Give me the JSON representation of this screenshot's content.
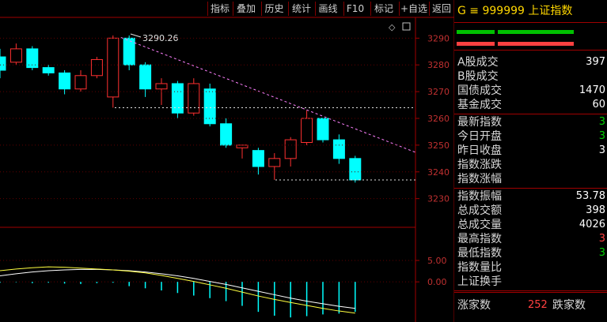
{
  "toolbar": {
    "buttons": [
      "指标",
      "叠加",
      "历史",
      "统计",
      "画线",
      "F10",
      "标记",
      "+自选",
      "返回"
    ]
  },
  "chart_data": {
    "type": "candlestick",
    "y_axis_ticks": [
      3290,
      3280,
      3270,
      3260,
      3250,
      3240,
      3230
    ],
    "ylim": [
      3224,
      3296
    ],
    "high_annotation": "3290.26",
    "candles": [
      {
        "o": 3283,
        "c": 3278,
        "h": 3286,
        "l": 3275,
        "dir": "down"
      },
      {
        "o": 3281,
        "c": 3286,
        "h": 3288,
        "l": 3280,
        "dir": "up"
      },
      {
        "o": 3286,
        "c": 3279,
        "h": 3287,
        "l": 3278,
        "dir": "down"
      },
      {
        "o": 3279,
        "c": 3277,
        "h": 3280,
        "l": 3276,
        "dir": "down"
      },
      {
        "o": 3277,
        "c": 3271,
        "h": 3278,
        "l": 3269,
        "dir": "down"
      },
      {
        "o": 3271,
        "c": 3276,
        "h": 3278,
        "l": 3270,
        "dir": "up"
      },
      {
        "o": 3276,
        "c": 3282,
        "h": 3283,
        "l": 3275,
        "dir": "up"
      },
      {
        "o": 3268,
        "c": 3290,
        "h": 3291,
        "l": 3264,
        "dir": "up"
      },
      {
        "o": 3290,
        "c": 3280,
        "h": 3291,
        "l": 3278,
        "dir": "down"
      },
      {
        "o": 3280,
        "c": 3271,
        "h": 3281,
        "l": 3268,
        "dir": "down"
      },
      {
        "o": 3271,
        "c": 3273,
        "h": 3275,
        "l": 3265,
        "dir": "up"
      },
      {
        "o": 3273,
        "c": 3262,
        "h": 3274,
        "l": 3260,
        "dir": "down"
      },
      {
        "o": 3262,
        "c": 3273,
        "h": 3275,
        "l": 3261,
        "dir": "up"
      },
      {
        "o": 3271,
        "c": 3258,
        "h": 3273,
        "l": 3257,
        "dir": "down"
      },
      {
        "o": 3258,
        "c": 3250,
        "h": 3260,
        "l": 3249,
        "dir": "down"
      },
      {
        "o": 3249,
        "c": 3250,
        "h": 3250,
        "l": 3245,
        "dir": "up"
      },
      {
        "o": 3248,
        "c": 3242,
        "h": 3249,
        "l": 3239,
        "dir": "down"
      },
      {
        "o": 3242,
        "c": 3245,
        "h": 3247,
        "l": 3237,
        "dir": "up"
      },
      {
        "o": 3245,
        "c": 3252,
        "h": 3253,
        "l": 3242,
        "dir": "up"
      },
      {
        "o": 3251,
        "c": 3260,
        "h": 3263,
        "l": 3250,
        "dir": "up"
      },
      {
        "o": 3260,
        "c": 3252,
        "h": 3260,
        "l": 3251,
        "dir": "down"
      },
      {
        "o": 3252,
        "c": 3245,
        "h": 3254,
        "l": 3243,
        "dir": "down"
      },
      {
        "o": 3245,
        "c": 3237,
        "h": 3246,
        "l": 3236,
        "dir": "down"
      }
    ],
    "sub_axis_ticks": [
      "5.00",
      "0.00"
    ],
    "sub_ylim": [
      -9,
      12
    ],
    "sub_bars": [
      -0.2,
      -0.1,
      -0.3,
      -0.2,
      -0.4,
      -0.5,
      -0.3,
      -0.2,
      -1.0,
      -1.5,
      -2.0,
      -2.6,
      -3.2,
      -3.8,
      -4.5,
      -5.6,
      -7.0,
      -7.9,
      -8.3,
      -8.0,
      -7.6,
      -7.4,
      -7.0
    ],
    "sub_line_yellow": [
      2.6,
      3.0,
      3.3,
      3.5,
      3.4,
      3.2,
      3.0,
      2.8,
      2.5,
      2.1,
      1.5,
      0.8,
      0.1,
      -0.7,
      -1.5,
      -2.4,
      -3.3,
      -4.1,
      -4.8,
      -5.5,
      -6.2,
      -6.8,
      -7.3
    ],
    "sub_line_white": [
      1.4,
      1.9,
      2.3,
      2.6,
      2.8,
      2.9,
      2.9,
      2.8,
      2.6,
      2.3,
      1.9,
      1.4,
      0.8,
      0.1,
      -0.6,
      -1.4,
      -2.2,
      -3.0,
      -3.8,
      -4.5,
      -5.1,
      -5.7,
      -6.2
    ]
  },
  "side": {
    "title": "G ≡ 999999 上证指数",
    "rows": [
      {
        "label": "A股成交",
        "value": "397",
        "cls": "val-white"
      },
      {
        "label": "B股成交",
        "value": "",
        "cls": "val-white"
      },
      {
        "label": "国债成交",
        "value": "1470",
        "cls": "val-white"
      },
      {
        "label": "基金成交",
        "value": "60",
        "cls": "val-white"
      },
      {
        "label": "最新指数",
        "value": "3",
        "cls": "val-green"
      },
      {
        "label": "今日开盘",
        "value": "3",
        "cls": "val-green"
      },
      {
        "label": "昨日收盘",
        "value": "3",
        "cls": "val-white"
      },
      {
        "label": "指数涨跌",
        "value": "",
        "cls": "val-white"
      },
      {
        "label": "指数涨幅",
        "value": "",
        "cls": "val-white"
      },
      {
        "label": "指数振幅",
        "value": "53.78",
        "cls": "val-white"
      },
      {
        "label": "总成交额",
        "value": "398",
        "cls": "val-white"
      },
      {
        "label": "总成交量",
        "value": "4026",
        "cls": "val-white"
      },
      {
        "label": "最高指数",
        "value": "3",
        "cls": "val-red"
      },
      {
        "label": "最低指数",
        "value": "3",
        "cls": "val-green"
      },
      {
        "label": "指数量比",
        "value": "",
        "cls": "val-white"
      },
      {
        "label": "上证换手",
        "value": "",
        "cls": "val-white"
      }
    ],
    "advance": {
      "label": "涨家数",
      "value": "252",
      "label2": "跌家数"
    }
  }
}
